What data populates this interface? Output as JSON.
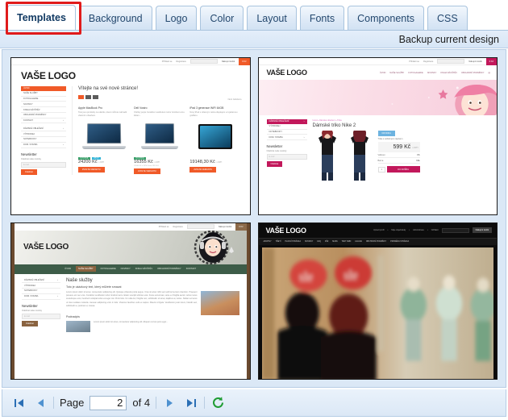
{
  "tabs": [
    {
      "label": "Templates",
      "active": true
    },
    {
      "label": "Background",
      "active": false
    },
    {
      "label": "Logo",
      "active": false
    },
    {
      "label": "Color",
      "active": false
    },
    {
      "label": "Layout",
      "active": false
    },
    {
      "label": "Fonts",
      "active": false
    },
    {
      "label": "Components",
      "active": false
    },
    {
      "label": "CSS",
      "active": false
    }
  ],
  "toolbar": {
    "backup_label": "Backup current design"
  },
  "pager": {
    "first_icon": "first-page-icon",
    "prev_icon": "previous-page-icon",
    "page_label": "Page",
    "page_value": "2",
    "of_label": "of 4",
    "next_icon": "next-page-icon",
    "last_icon": "last-page-icon",
    "refresh_icon": "refresh-icon",
    "total_pages": "4"
  },
  "colors": {
    "panel_bg": "#dbe8f6",
    "tab_active": "#ffffff",
    "highlight": "#e01b1b",
    "t1_accent": "#f05a28",
    "t2_accent": "#c2185b",
    "t3_accent": "#3d5c48",
    "t4_accent": "#0c0c0c"
  },
  "templates": [
    {
      "name": "eshop-orange",
      "logo": "VAŠE LOGO",
      "topbar": {
        "login": "Přihlásit se",
        "register": "Registrace",
        "search_placeholder": "Vyhledávání",
        "cart": "Nákupní košík",
        "cart_total": "0 Kč"
      },
      "menu": [
        "ÚVOD",
        "NAŠE SLUŽBY",
        "FOTOGALERIE",
        "NOVINKY",
        "KNIHA NÁVŠTĚV",
        "OBCHODNÍ PODMÍNKY",
        "KONTAKT",
        "DÁMSKÉ OBLEČENÍ",
        "VÝPRODEJ",
        "NOTEBOOKY",
        "DOM. STAVBA"
      ],
      "newsletter": {
        "title": "Newsletter",
        "note": "Odebírat naše novinky",
        "placeholder": "E-mail",
        "button": "Odebírat"
      },
      "heading": "Vítejte na své nové stránce!",
      "sort_label": "Není zařazeno",
      "products": [
        {
          "title": "Apple MacBook Pro",
          "desc": "Toto jsou produkty na ukázku, které můžete nahradit vlastním obsahem.",
          "price": "24200 Kč",
          "vat": "s DPH",
          "tags": [
            "NOVINKA",
            "AKCE"
          ],
          "button": "ZVOLTE VARIANTU"
        },
        {
          "title": "Dell Vostro",
          "desc": "Křehký popis Curabitur vestibulum tortor tincidunt arcu. Etiam...",
          "price": "16355 Kč",
          "vat": "s DPH",
          "note": "16550 Kč s DPH Cena 1913 Kč",
          "tags": [
            "NOVINKA"
          ],
          "button": "ZVOLTE VARIANTU"
        },
        {
          "title": "iPad 3 generace WiFi 64GB",
          "desc": "Nový iPad s úžasným retina displejem a 4-jádernou grafikou.",
          "price": "19148,30 Kč",
          "vat": "s DPH",
          "tags": [],
          "button": "ZVOLTE VARIANTU"
        }
      ]
    },
    {
      "name": "fashion-pink",
      "logo": "VAŠE LOGO",
      "topbar": {
        "login": "Přihlásit se",
        "register": "Registrace",
        "search_placeholder": "Vyhledávání",
        "cart": "Nákupní košík",
        "cart_total": "0 Kč"
      },
      "nav": [
        "ÚVOD",
        "NAŠE SLUŽBY",
        "FOTOGALERIE",
        "NOVINKY",
        "KNIHA NÁVŠTĚV",
        "OBCHODNÍ PODMÍNKY"
      ],
      "menu": [
        "DÁMSKÉ OBLEČENÍ",
        "VÝPRODEJ",
        "NOTEBOOKY",
        "DOM. STAVBA"
      ],
      "newsletter": {
        "title": "Newsletter",
        "note": "Odebírat naše novinky",
        "placeholder": "E-mail",
        "button": "Odebírat"
      },
      "breadcrumb": "Úvod » Dámské oblečení » Trika",
      "heading": "Dámské triko Nike 2",
      "badge": "NOVINKA",
      "subtitle": "Trika s ozdobným nápisem",
      "price": "599 Kč",
      "vat": "s DPH",
      "options": [
        {
          "label": "Velikost",
          "value": "XS"
        },
        {
          "label": "Barva",
          "value": "bílá"
        }
      ],
      "qty": "1",
      "button": "DO KOŠÍKU"
    },
    {
      "name": "services-green",
      "logo": "VAŠE LOGO",
      "topbar": {
        "login": "Přihlásit se",
        "register": "Registrace",
        "search_placeholder": "Vyhledávání",
        "cart": "Nákupní košík",
        "cart_total": "0 Kč"
      },
      "nav": [
        "ÚVOD",
        "NAŠE SLUŽBY",
        "FOTOGALERIE",
        "NOVINKY",
        "KNIHA NÁVŠTĚV",
        "OBCHODNÍ PODMÍNKY",
        "KONTAKT"
      ],
      "nav_active": "NAŠE SLUŽBY",
      "menu": [
        "DÁMSKÉ OBLEČENÍ",
        "VÝPRODEJ",
        "NOTEBOOKY",
        "DOM. STAVBA"
      ],
      "newsletter": {
        "title": "Newsletter",
        "note": "Odebírat naše novinky",
        "placeholder": "E-mail",
        "button": "Odebírat"
      },
      "heading": "Naše služby",
      "subheading": "Toto je ukázkový text, který můžete smazat",
      "paragraph": "Lorem ipsum dolor sit amet, consectetur adipiscing elit. Quisque pharetra porta augue. Cras sit amet nibh sed velit fermentum interdum. Praesent posuere est nec eros. Curabitur vestibulum tortor tincidunt arcu. Etiam suscipit ultricies erat. Fusce accumsan, ante eu fringilla auctor, tellus metus scelerisque eros, hendrerit volutpat tellus est eget nisi. Proin felis. Ut nulla dui, fringilla non, sollicitudin sit amet, dapibus at, lectus. Nullam ac lacus ut risus sodales molestie. Aenean adipiscing enim in felis. Vivamus faucibus velit eu sapien. Mauris id ligula. Vestibulum justo lorem, blandit sed, sollicitudin a, pulvinar et, massa.",
      "subheading2": "Podnadpis",
      "paragraph2": "Lorem ipsum dolor sit amet, consectetur adipiscing elit. Aliquam cursus justo eget..."
    },
    {
      "name": "shop-dark",
      "logo": "VAŠE LOGO",
      "topbar": {
        "profile": "Upravit profil",
        "orders": "Moje objednávky",
        "admin": "Administrace",
        "logout": "Odhlásit",
        "search_placeholder": "Vyhledávání",
        "cart": "Nákupní košík"
      },
      "nav": [
        "ARCHIVY",
        "TŘETÍ",
        "HLAVNÍ STRÁNKA",
        "NOVINKY",
        "FAQ",
        "ZŠZ",
        "MAPA",
        "TEST DMD",
        "LILIANA",
        "OBCHODNÍ PODMÍNKY",
        "PROMĚNA STRÁNKA"
      ]
    }
  ]
}
